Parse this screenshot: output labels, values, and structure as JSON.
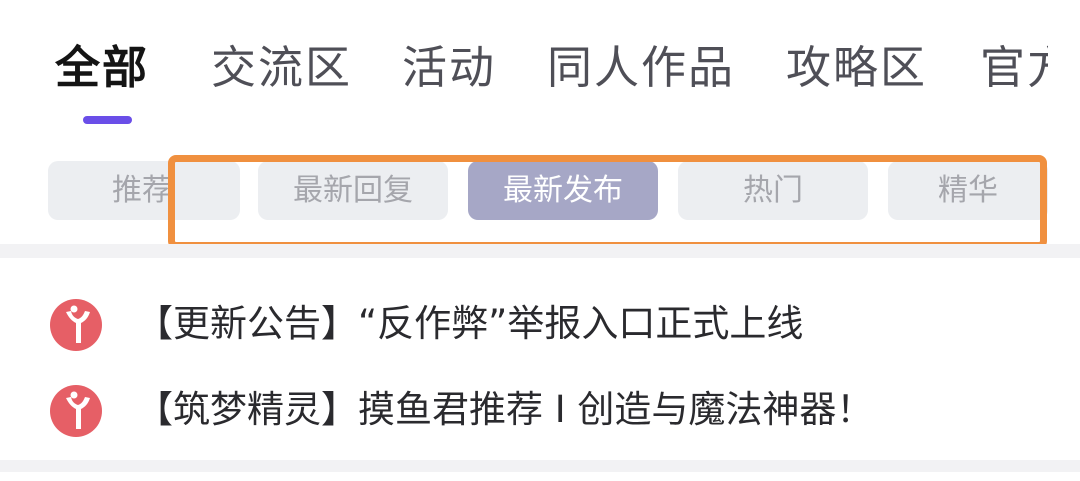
{
  "tabs": [
    {
      "label": "全部",
      "active": true
    },
    {
      "label": "交流区",
      "active": false
    },
    {
      "label": "活动",
      "active": false
    },
    {
      "label": "同人作品",
      "active": false
    },
    {
      "label": "攻略区",
      "active": false
    },
    {
      "label": "官方",
      "active": false
    }
  ],
  "sort_chips": [
    {
      "label": "推荐",
      "active": false
    },
    {
      "label": "最新回复",
      "active": false
    },
    {
      "label": "最新发布",
      "active": true
    },
    {
      "label": "热门",
      "active": false
    },
    {
      "label": "精华",
      "active": false
    }
  ],
  "pinned_posts": [
    {
      "title": "【更新公告】“反作弊”举报入口正式上线",
      "icon": "pin-icon"
    },
    {
      "title": "【筑梦精灵】摸鱼君推荐 I 创造与魔法神器！",
      "icon": "pin-icon"
    }
  ],
  "colors": {
    "accent": "#6a4ee8",
    "chip_active": "#a6a7c6",
    "highlight": "#f0903f",
    "pin_icon": "#e65f66"
  }
}
